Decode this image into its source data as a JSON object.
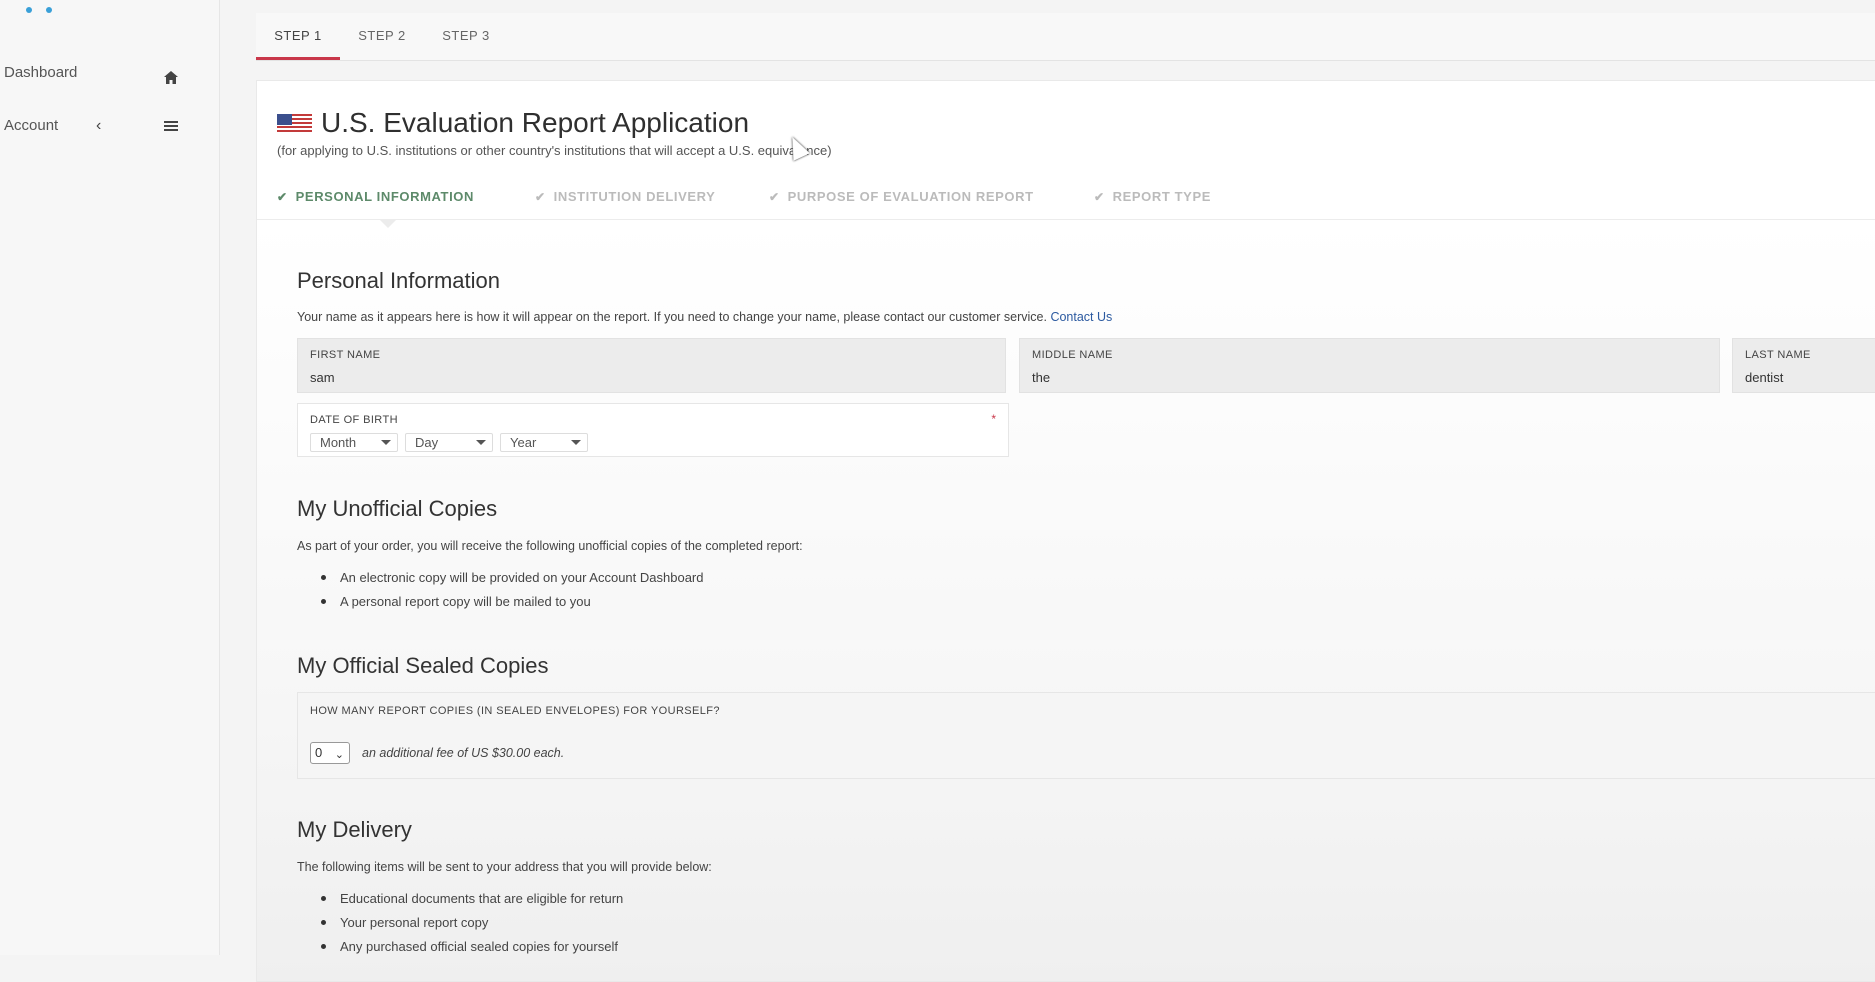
{
  "sidebar": {
    "items": [
      {
        "label": "Dashboard",
        "icon": "home-icon"
      },
      {
        "label": "Account",
        "icon": "menu-icon"
      }
    ]
  },
  "steps": [
    "STEP 1",
    "STEP 2",
    "STEP 3"
  ],
  "header": {
    "title": "U.S. Evaluation Report Application",
    "subtitle": "(for applying to U.S. institutions or other country's institutions that will accept a U.S. equivalence)"
  },
  "section_nav": [
    "PERSONAL INFORMATION",
    "INSTITUTION DELIVERY",
    "PURPOSE OF EVALUATION REPORT",
    "REPORT TYPE"
  ],
  "personal": {
    "heading": "Personal Information",
    "note": "Your name as it appears here is how it will appear on the report. If you need to change your name, please contact our customer service.",
    "contact_link": "Contact Us",
    "first_name_label": "FIRST NAME",
    "first_name": "sam",
    "middle_name_label": "MIDDLE NAME",
    "middle_name": "the",
    "last_name_label": "LAST NAME",
    "last_name": "dentist",
    "dob_label": "DATE OF BIRTH",
    "required_mark": "*",
    "month": "Month",
    "day": "Day",
    "year": "Year"
  },
  "unofficial": {
    "heading": "My Unofficial Copies",
    "intro": "As part of your order, you will receive the following unofficial copies of the completed report:",
    "items": [
      "An electronic copy will be provided on your Account Dashboard",
      "A personal report copy will be mailed to you"
    ]
  },
  "official": {
    "heading": "My Official Sealed Copies",
    "question": "HOW MANY REPORT COPIES (IN SEALED ENVELOPES) FOR YOURSELF?",
    "quantity": "0",
    "fee": "an additional fee of US $30.00 each."
  },
  "delivery": {
    "heading": "My Delivery",
    "intro": "The following items will be sent to your address that you will provide below:",
    "items": [
      "Educational documents that are eligible for return",
      "Your personal report copy",
      "Any purchased official sealed copies for yourself"
    ]
  },
  "colors": {
    "accent": "#c9374a",
    "active_nav": "#5d8a6a",
    "link": "#2c5aa0"
  }
}
